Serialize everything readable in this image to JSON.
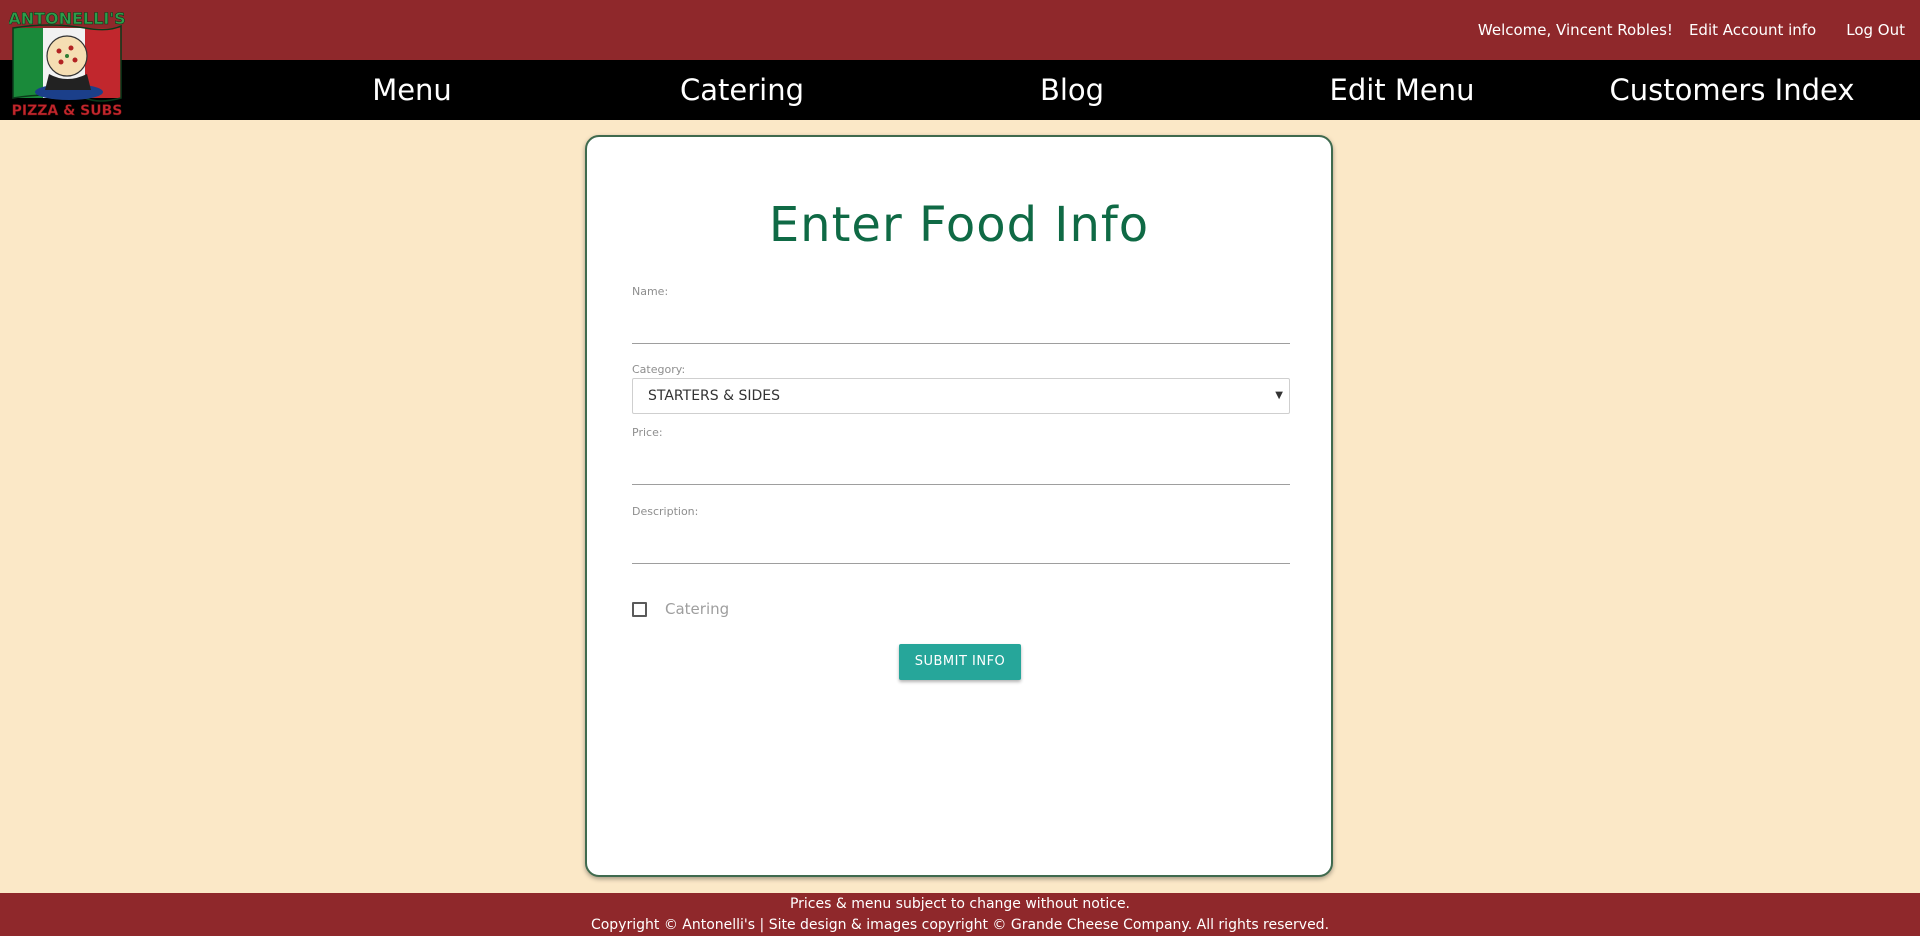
{
  "header": {
    "welcome_text": "Welcome, Vincent Robles!",
    "edit_account_label": "Edit Account info",
    "logout_label": "Log Out",
    "background_color": "#8f282b"
  },
  "logo": {
    "top_text": "ANTONELLI'S",
    "bottom_text": "PIZZA & SUBS",
    "icon": "pizza-chef-logo"
  },
  "nav": {
    "items": [
      {
        "label": "Menu"
      },
      {
        "label": "Catering"
      },
      {
        "label": "Blog"
      },
      {
        "label": "Edit Menu"
      },
      {
        "label": "Customers Index"
      }
    ]
  },
  "form": {
    "title": "Enter Food Info",
    "name_label": "Name:",
    "name_value": "",
    "category_label": "Category:",
    "category_value": "STARTERS & SIDES",
    "price_label": "Price:",
    "price_value": "",
    "description_label": "Description:",
    "description_value": "",
    "catering_label": "Catering",
    "catering_checked": false,
    "submit_label": "SUBMIT INFO",
    "title_color": "#0f6a45",
    "button_color": "#26a69a"
  },
  "footer": {
    "line1": "Prices & menu subject to change without notice.",
    "line2": "Copyright © Antonelli's | Site design & images copyright © Grande Cheese Company. All rights reserved."
  },
  "page": {
    "background_color": "#fbe8c7"
  }
}
